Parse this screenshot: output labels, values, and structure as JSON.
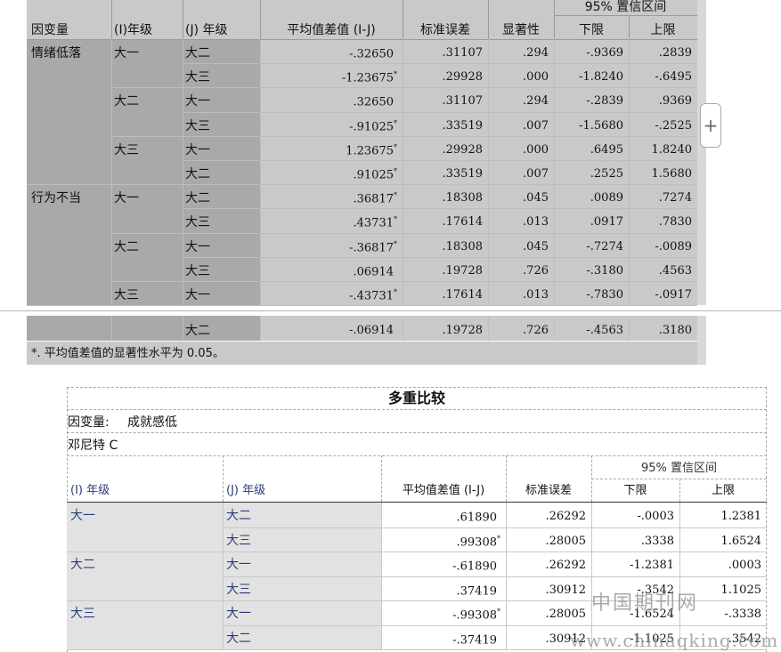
{
  "top_table": {
    "headers": {
      "dep_var": "因变量",
      "i_grade": "(I)年级",
      "j_grade": "(J) 年级",
      "mean_diff": "平均值差值 (I-J)",
      "std_err": "标准误差",
      "sig": "显著性",
      "ci": "95% 置信区间",
      "lower": "下限",
      "upper": "上限"
    },
    "groups": [
      {
        "dep": "情绪低落",
        "subgroups": [
          {
            "i": "大一",
            "rows": [
              {
                "j": "大二",
                "mean": "-.32650",
                "star": "",
                "se": ".31107",
                "sig": ".294",
                "lo": "-.9369",
                "hi": ".2839"
              },
              {
                "j": "大三",
                "mean": "-1.23675",
                "star": "*",
                "se": ".29928",
                "sig": ".000",
                "lo": "-1.8240",
                "hi": "-.6495"
              }
            ]
          },
          {
            "i": "大二",
            "rows": [
              {
                "j": "大一",
                "mean": ".32650",
                "star": "",
                "se": ".31107",
                "sig": ".294",
                "lo": "-.2839",
                "hi": ".9369"
              },
              {
                "j": "大三",
                "mean": "-.91025",
                "star": "*",
                "se": ".33519",
                "sig": ".007",
                "lo": "-1.5680",
                "hi": "-.2525"
              }
            ]
          },
          {
            "i": "大三",
            "rows": [
              {
                "j": "大一",
                "mean": "1.23675",
                "star": "*",
                "se": ".29928",
                "sig": ".000",
                "lo": ".6495",
                "hi": "1.8240"
              },
              {
                "j": "大二",
                "mean": ".91025",
                "star": "*",
                "se": ".33519",
                "sig": ".007",
                "lo": ".2525",
                "hi": "1.5680"
              }
            ]
          }
        ]
      },
      {
        "dep": "行为不当",
        "subgroups": [
          {
            "i": "大一",
            "rows": [
              {
                "j": "大二",
                "mean": ".36817",
                "star": "*",
                "se": ".18308",
                "sig": ".045",
                "lo": ".0089",
                "hi": ".7274"
              },
              {
                "j": "大三",
                "mean": ".43731",
                "star": "*",
                "se": ".17614",
                "sig": ".013",
                "lo": ".0917",
                "hi": ".7830"
              }
            ]
          },
          {
            "i": "大二",
            "rows": [
              {
                "j": "大一",
                "mean": "-.36817",
                "star": "*",
                "se": ".18308",
                "sig": ".045",
                "lo": "-.7274",
                "hi": "-.0089"
              },
              {
                "j": "大三",
                "mean": ".06914",
                "star": "",
                "se": ".19728",
                "sig": ".726",
                "lo": "-.3180",
                "hi": ".4563"
              }
            ]
          },
          {
            "i": "大三",
            "rows": [
              {
                "j": "大一",
                "mean": "-.43731",
                "star": "*",
                "se": ".17614",
                "sig": ".013",
                "lo": "-.7830",
                "hi": "-.0917"
              }
            ]
          }
        ]
      }
    ],
    "continued_row": {
      "j": "大二",
      "mean": "-.06914",
      "star": "",
      "se": ".19728",
      "sig": ".726",
      "lo": "-.4563",
      "hi": ".3180"
    },
    "footnote": "*. 平均值差值的显著性水平为 0.05。"
  },
  "bottom_table": {
    "title": "多重比较",
    "dep_var_label": "因变量:",
    "dep_var_value": "成就感低",
    "method": "邓尼特 C",
    "headers": {
      "i_grade": "(I) 年级",
      "j_grade": "(J) 年级",
      "mean_diff": "平均值差值 (I-J)",
      "std_err": "标准误差",
      "ci": "95% 置信区间",
      "lower": "下限",
      "upper": "上限"
    },
    "groups": [
      {
        "i": "大一",
        "rows": [
          {
            "j": "大二",
            "mean": ".61890",
            "star": "",
            "se": ".26292",
            "lo": "-.0003",
            "hi": "1.2381"
          },
          {
            "j": "大三",
            "mean": ".99308",
            "star": "*",
            "se": ".28005",
            "lo": ".3338",
            "hi": "1.6524"
          }
        ]
      },
      {
        "i": "大二",
        "rows": [
          {
            "j": "大一",
            "mean": "-.61890",
            "star": "",
            "se": ".26292",
            "lo": "-1.2381",
            "hi": ".0003"
          },
          {
            "j": "大三",
            "mean": ".37419",
            "star": "",
            "se": ".30912",
            "lo": "-.3542",
            "hi": "1.1025"
          }
        ]
      },
      {
        "i": "大三",
        "rows": [
          {
            "j": "大一",
            "mean": "-.99308",
            "star": "*",
            "se": ".28005",
            "lo": "-1.6524",
            "hi": "-.3338"
          },
          {
            "j": "大二",
            "mean": "-.37419",
            "star": "",
            "se": ".30912",
            "lo": "-1.1025",
            "hi": ".3542"
          }
        ]
      }
    ]
  },
  "watermark": {
    "cn": "中国期刊网",
    "url": "www.chinaqking.com"
  },
  "expand_button": {
    "label": "+"
  }
}
